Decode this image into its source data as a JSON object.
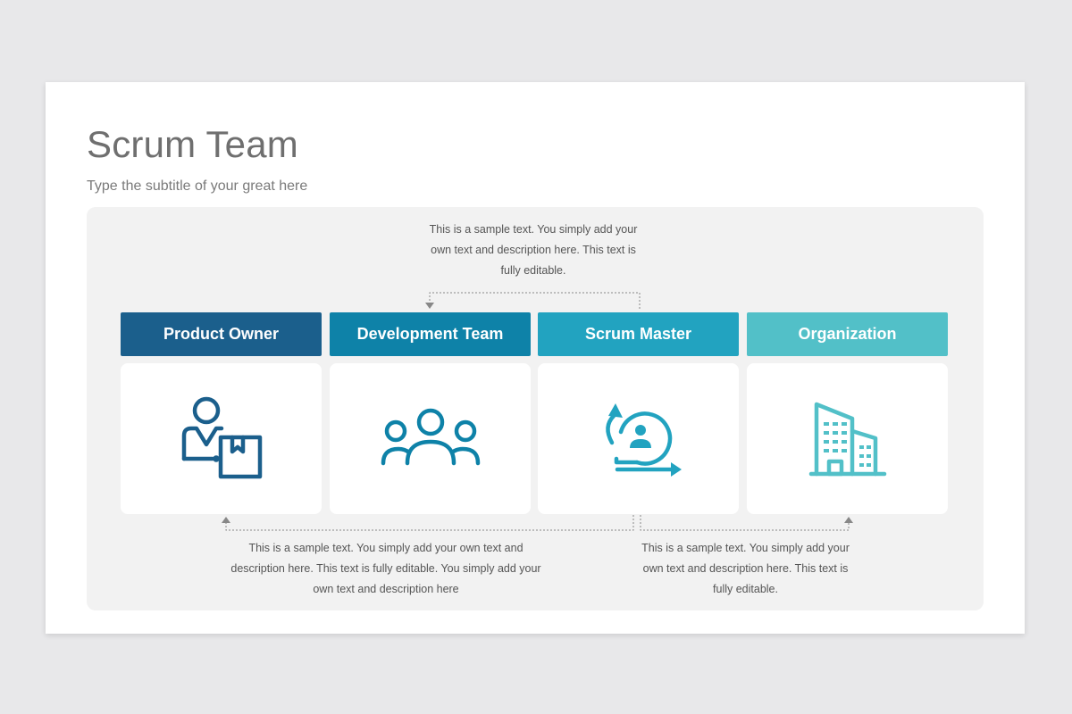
{
  "slide": {
    "title": "Scrum Team",
    "subtitle": "Type the subtitle of your great here"
  },
  "notes": {
    "top": "This is a sample text. You simply add your own text and description here. This text is fully editable.",
    "bottom_left": "This is a sample text. You simply add your own text and description here. This text is fully editable. You simply add your own text and description here",
    "bottom_right": "This is a sample text. You simply add your own text and description here. This text is fully editable."
  },
  "columns": [
    {
      "label": "Product Owner",
      "color": "#1b5f8c",
      "icon": "product-owner-icon",
      "icon_color": "#1b5f8c"
    },
    {
      "label": "Development Team",
      "color": "#0e82a8",
      "icon": "team-icon",
      "icon_color": "#0e82a8"
    },
    {
      "label": "Scrum Master",
      "color": "#22a3c0",
      "icon": "scrum-cycle-icon",
      "icon_color": "#22a3c0"
    },
    {
      "label": "Organization",
      "color": "#52c0c8",
      "icon": "building-icon",
      "icon_color": "#52c0c8"
    }
  ],
  "connector_color": "#888888"
}
